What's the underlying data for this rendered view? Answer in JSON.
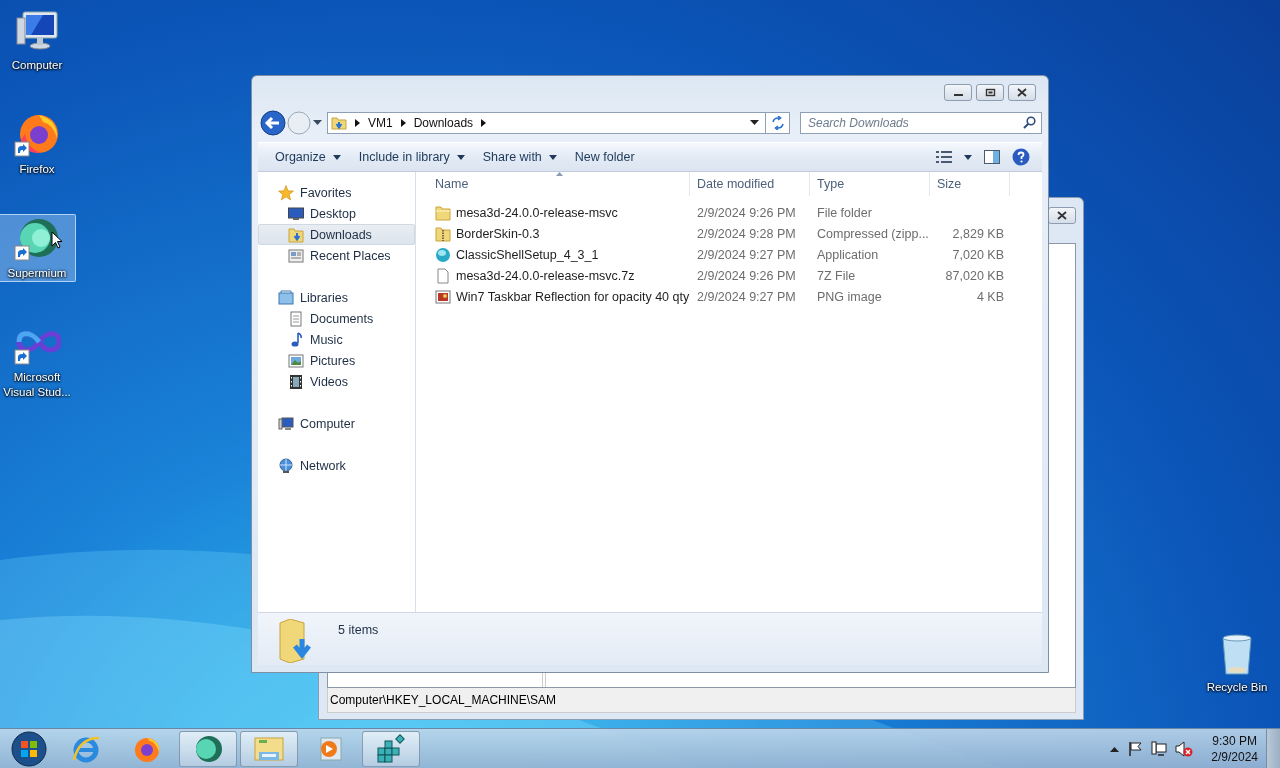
{
  "desktop_icons": [
    {
      "label": "Computer",
      "kind": "computer",
      "selected": false
    },
    {
      "label": "Firefox",
      "kind": "firefox",
      "selected": false
    },
    {
      "label": "Supermium",
      "kind": "supermium",
      "selected": true
    },
    {
      "label": "Microsoft Visual Stud...",
      "kind": "vs",
      "selected": false
    }
  ],
  "recycle_bin": {
    "label": "Recycle Bin"
  },
  "background_window": {
    "status_text": "Computer\\HKEY_LOCAL_MACHINE\\SAM"
  },
  "explorer": {
    "breadcrumb": [
      "VM1",
      "Downloads"
    ],
    "search": {
      "placeholder": "Search Downloads"
    },
    "toolbar": [
      {
        "label": "Organize",
        "dropdown": true
      },
      {
        "label": "Include in library",
        "dropdown": true
      },
      {
        "label": "Share with",
        "dropdown": true
      },
      {
        "label": "New folder",
        "dropdown": false
      }
    ],
    "nav": [
      {
        "label": "Favorites",
        "kind": "star",
        "selected": false,
        "children": [
          {
            "label": "Desktop",
            "kind": "desktop",
            "selected": false
          },
          {
            "label": "Downloads",
            "kind": "downloads",
            "selected": true
          },
          {
            "label": "Recent Places",
            "kind": "recent",
            "selected": false
          }
        ]
      },
      {
        "label": "Libraries",
        "kind": "library",
        "selected": false,
        "children": [
          {
            "label": "Documents",
            "kind": "documents",
            "selected": false
          },
          {
            "label": "Music",
            "kind": "music",
            "selected": false
          },
          {
            "label": "Pictures",
            "kind": "pictures",
            "selected": false
          },
          {
            "label": "Videos",
            "kind": "videos",
            "selected": false
          }
        ]
      },
      {
        "label": "Computer",
        "kind": "computer",
        "selected": false
      },
      {
        "label": "Network",
        "kind": "network",
        "selected": false
      }
    ],
    "columns": [
      {
        "label": "Name",
        "sorted": true
      },
      {
        "label": "Date modified",
        "sorted": false
      },
      {
        "label": "Type",
        "sorted": false
      },
      {
        "label": "Size",
        "sorted": false
      }
    ],
    "rows": [
      {
        "name": "mesa3d-24.0.0-release-msvc",
        "date": "2/9/2024 9:26 PM",
        "type": "File folder",
        "size": "",
        "kind": "folder"
      },
      {
        "name": "BorderSkin-0.3",
        "date": "2/9/2024 9:28 PM",
        "type": "Compressed (zipp...",
        "size": "2,829 KB",
        "kind": "zip"
      },
      {
        "name": "ClassicShellSetup_4_3_1",
        "date": "2/9/2024 9:27 PM",
        "type": "Application",
        "size": "7,020 KB",
        "kind": "app"
      },
      {
        "name": "mesa3d-24.0.0-release-msvc.7z",
        "date": "2/9/2024 9:26 PM",
        "type": "7Z File",
        "size": "87,020 KB",
        "kind": "file"
      },
      {
        "name": "Win7 Taskbar Reflection for opacity 40 qty",
        "date": "2/9/2024 9:27 PM",
        "type": "PNG image",
        "size": "4 KB",
        "kind": "image"
      }
    ],
    "status": "5 items"
  },
  "taskbar": {
    "apps": [
      {
        "kind": "ie",
        "open": false
      },
      {
        "kind": "firefox",
        "open": false
      },
      {
        "kind": "supermium",
        "open": true
      },
      {
        "kind": "explorer",
        "open": true
      },
      {
        "kind": "media",
        "open": false
      },
      {
        "kind": "regedit",
        "open": true
      }
    ],
    "time": "9:30 PM",
    "date": "2/9/2024"
  }
}
